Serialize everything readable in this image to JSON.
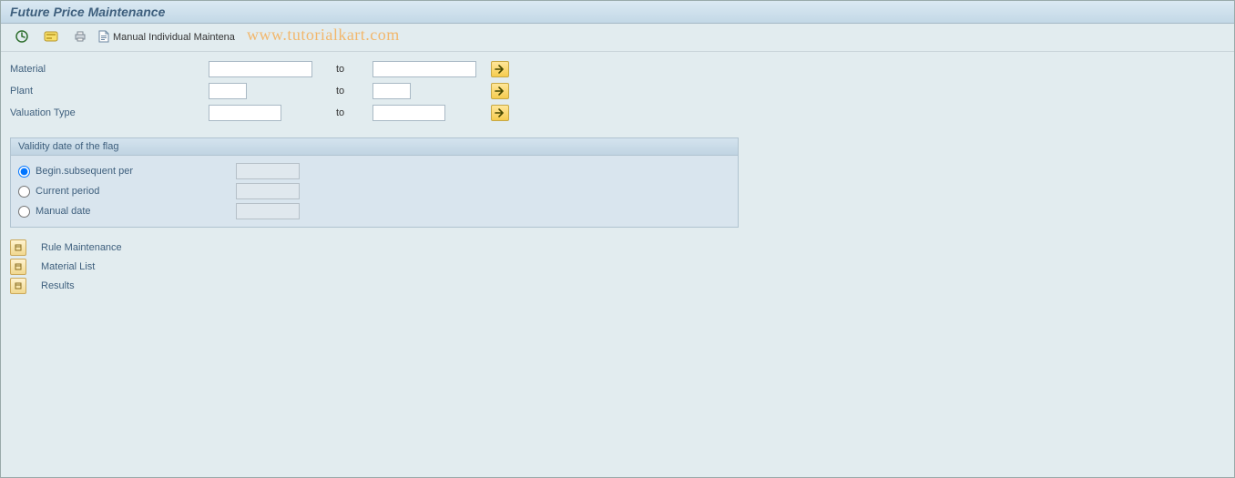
{
  "title": "Future Price Maintenance",
  "toolbar": {
    "manual_individual_label": "Manual Individual Maintena"
  },
  "watermark": "www.tutorialkart.com",
  "selection": {
    "material_label": "Material",
    "plant_label": "Plant",
    "valuation_type_label": "Valuation Type",
    "to_label": "to"
  },
  "groupbox": {
    "title": "Validity date of the flag",
    "options": {
      "begin_subsequent": "Begin.subsequent per",
      "current_period": "Current period",
      "manual_date": "Manual date"
    }
  },
  "expanders": {
    "rule_maintenance": "Rule Maintenance",
    "material_list": "Material List",
    "results": "Results"
  }
}
